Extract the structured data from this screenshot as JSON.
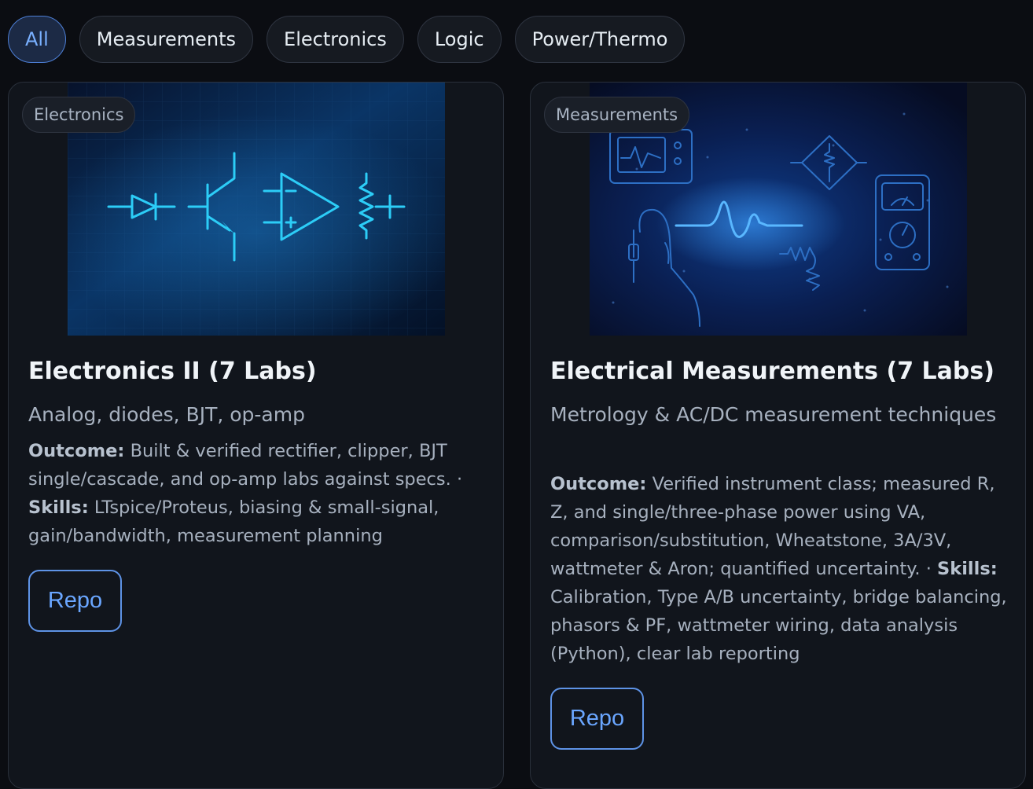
{
  "filters": [
    {
      "label": "All",
      "active": true
    },
    {
      "label": "Measurements",
      "active": false
    },
    {
      "label": "Electronics",
      "active": false
    },
    {
      "label": "Logic",
      "active": false
    },
    {
      "label": "Power/Thermo",
      "active": false
    }
  ],
  "cards": [
    {
      "tag": "Electronics",
      "title": "Electronics II (7 Labs)",
      "subtitle": "Analog, diodes, BJT, op-amp",
      "outcome_label": "Outcome:",
      "outcome": "Built & verified rectifier, clipper, BJT single/cascade, and op-amp labs against specs. ·",
      "skills_label": "Skills:",
      "skills": "LTspice/Proteus, biasing & small-signal, gain/bandwidth, measurement planning",
      "button": "Repo",
      "image_icon": "circuit-symbols-illustration"
    },
    {
      "tag": "Measurements",
      "title": "Electrical Measurements (7 Labs)",
      "subtitle": "Metrology & AC/DC measurement techniques",
      "outcome_label": "Outcome:",
      "outcome": "Verified instrument class; measured R, Z, and single/three-phase power using VA, comparison/substitution, Wheatstone, 3A/3V, wattmeter & Aron; quantified uncertainty. ·",
      "skills_label": "Skills:",
      "skills": "Calibration, Type A/B uncertainty, bridge balancing, phasors & PF, wattmeter wiring, data analysis (Python), clear lab reporting",
      "button": "Repo",
      "image_icon": "measurement-instruments-illustration"
    }
  ],
  "colors": {
    "accent": "#6aa6ff",
    "background": "#0b0d12",
    "card": "#11151c",
    "glow": "#27c8ff"
  }
}
